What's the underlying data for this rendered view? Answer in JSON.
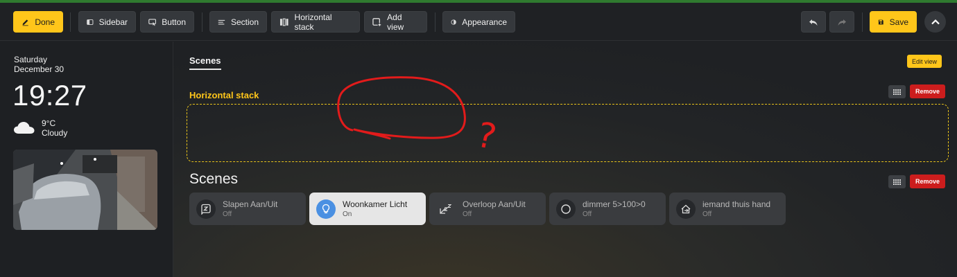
{
  "toolbar": {
    "done": "Done",
    "sidebar": "Sidebar",
    "button": "Button",
    "section": "Section",
    "horizontal_stack": "Horizontal stack",
    "add_view": "Add view",
    "appearance": "Appearance",
    "save": "Save"
  },
  "sidebar": {
    "day": "Saturday",
    "date": "December 30",
    "time": "19:27",
    "temperature": "9°C",
    "condition": "Cloudy",
    "weather_icon": "cloud-icon"
  },
  "view": {
    "tab_title": "Scenes",
    "edit_view": "Edit view",
    "horizontal_stack_label": "Horizontal stack",
    "remove": "Remove",
    "section_title": "Scenes"
  },
  "annotation": {
    "mark": "?"
  },
  "tiles": [
    {
      "name": "Slapen Aan/Uit",
      "state": "Off",
      "icon": "sleep-icon",
      "on": false
    },
    {
      "name": "Woonkamer Licht",
      "state": "On",
      "icon": "lightbulb-icon",
      "on": true
    },
    {
      "name": "Overloop Aan/Uit",
      "state": "Off",
      "icon": "snooze-icon",
      "on": false
    },
    {
      "name": "dimmer 5>100>0",
      "state": "Off",
      "icon": "circle-icon",
      "on": false
    },
    {
      "name": "iemand thuis hand",
      "state": "Off",
      "icon": "home-arrow-icon",
      "on": false
    }
  ],
  "colors": {
    "accent": "#ffc61a",
    "danger": "#cc1d1d",
    "active_icon": "#4a90e2"
  }
}
